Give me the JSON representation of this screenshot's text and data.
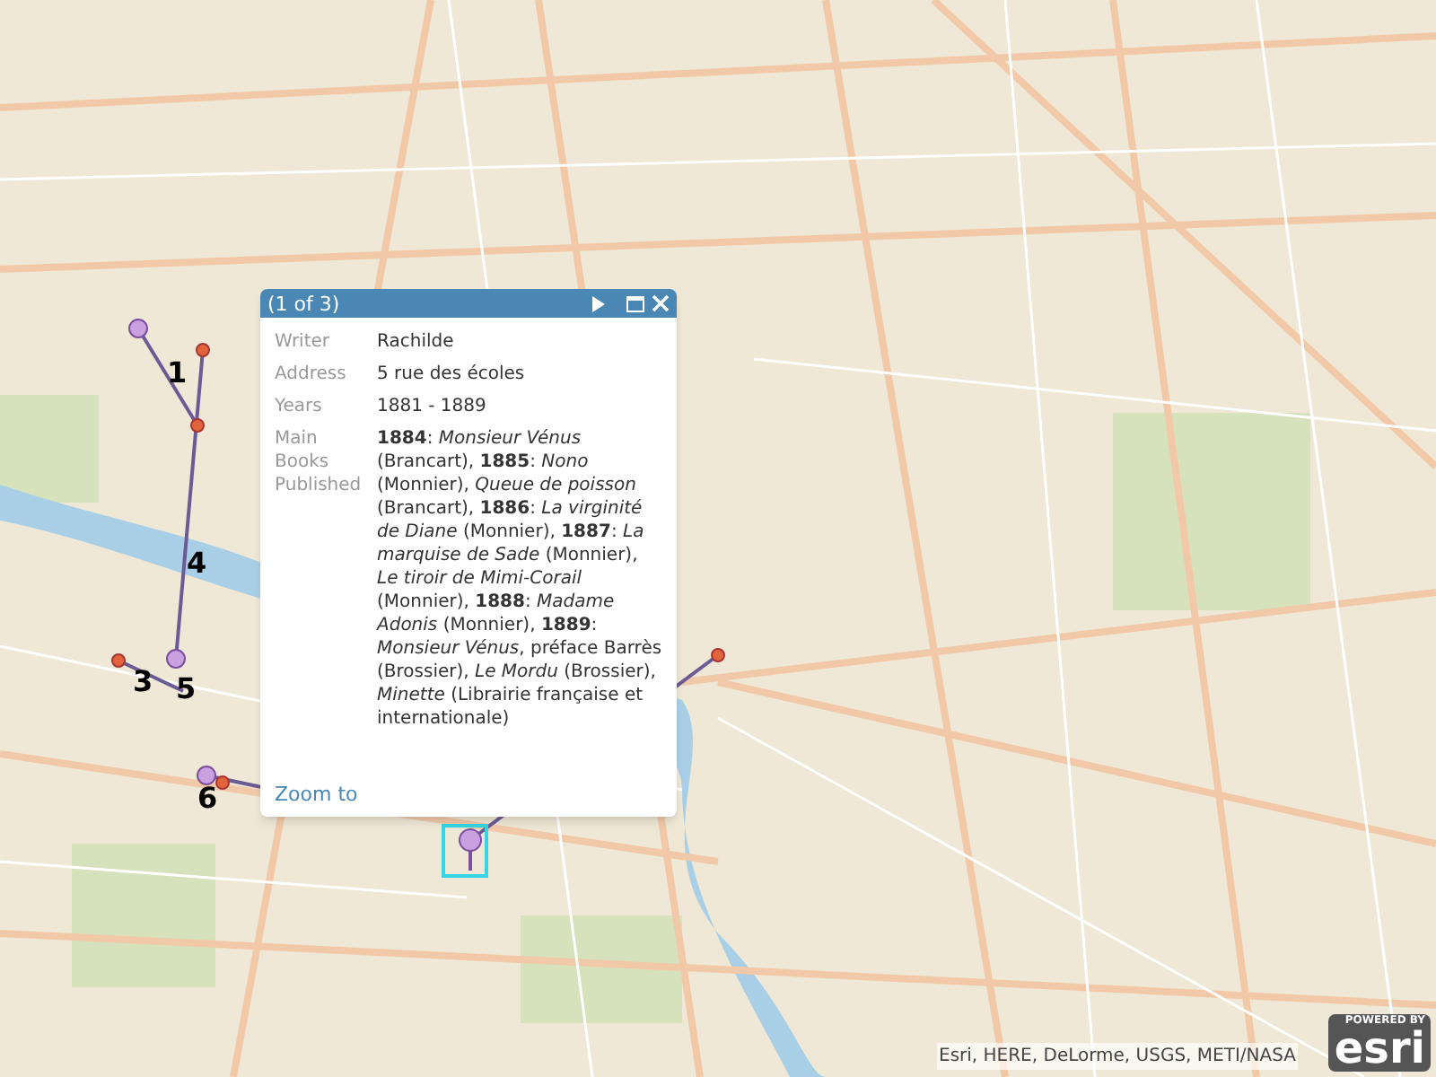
{
  "popup": {
    "title": "(1 of 3)",
    "fields": [
      {
        "label": "Writer",
        "value": "Rachilde"
      },
      {
        "label": "Address",
        "value": "5 rue des écoles"
      },
      {
        "label": "Years",
        "value": "1881 - 1889"
      },
      {
        "label": "Main Books Published",
        "value": "**1884**: *Monsieur Vénus* (Brancart), **1885**: *Nono* (Monnier), *Queue de poisson* (Brancart), **1886**: *La virginité de Diane* (Monnier), **1887**: *La marquise de Sade* (Monnier), *Le tiroir de Mimi-Corail* (Monnier), **1888**: *Madame Adonis* (Monnier), **1889**: *Monsieur Vénus*, préface Barrès (Brossier), *Le Mordu* (Brossier), *Minette* (Librairie française et internationale)"
      }
    ],
    "link": "Zoom to"
  },
  "route_labels": [
    "1",
    "4",
    "3",
    "5",
    "6"
  ],
  "attribution": "Esri, HERE, DeLorme, USGS, METI/NASA",
  "logo": {
    "tagline": "POWERED BY",
    "name": "esri"
  }
}
